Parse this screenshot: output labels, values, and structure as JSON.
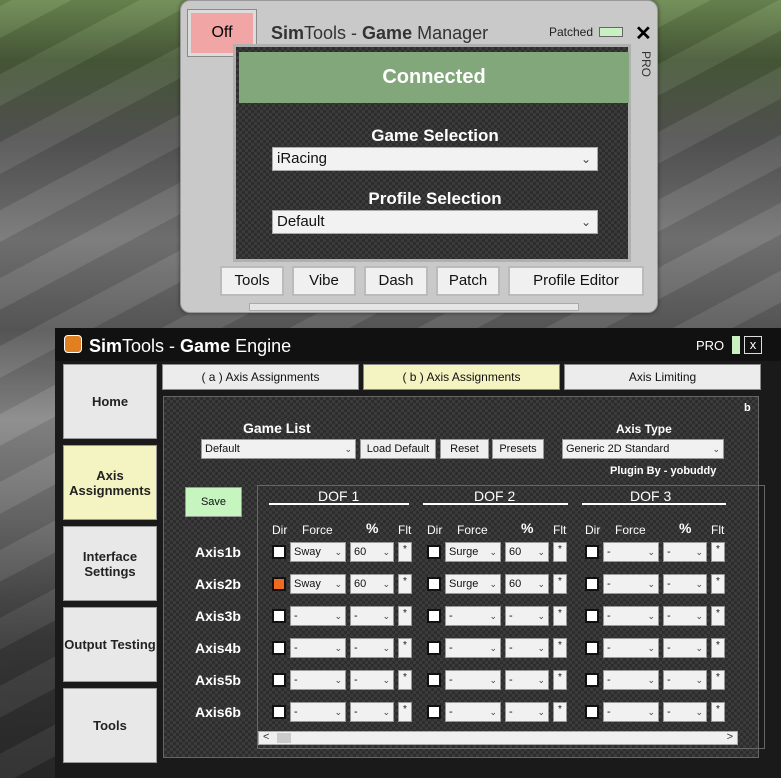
{
  "manager": {
    "off_label": "Off",
    "title_a": "Sim",
    "title_b": "Tools - ",
    "title_c": "Game",
    "title_d": " Manager",
    "patched_label": "Patched",
    "close_glyph": "✕",
    "pro_label": "PRO",
    "status": "Connected",
    "game_selection_label": "Game Selection",
    "game_selection_value": "iRacing",
    "profile_selection_label": "Profile Selection",
    "profile_selection_value": "Default",
    "tabs": [
      "Tools",
      "Vibe",
      "Dash",
      "Patch",
      "Profile Editor"
    ]
  },
  "engine": {
    "title_a": "Sim",
    "title_b": "Tools - ",
    "title_c": "Game",
    "title_d": " Engine",
    "pro_label": "PRO",
    "close_glyph": "x",
    "nav": [
      "Home",
      "Axis Assignments",
      "Interface Settings",
      "Output Testing",
      "Tools"
    ],
    "tabs": [
      "( a ) Axis Assignments",
      "( b ) Axis Assignments",
      "Axis Limiting"
    ],
    "corner_label": "b",
    "game_list_label": "Game List",
    "game_list_value": "Default",
    "load_default": "Load Default",
    "reset": "Reset",
    "presets": "Presets",
    "axis_type_label": "Axis Type",
    "axis_type_value": "Generic 2D Standard",
    "plugin_by": "Plugin By - yobuddy",
    "save": "Save",
    "dofs": [
      "DOF 1",
      "DOF 2",
      "DOF 3"
    ],
    "col_dir": "Dir",
    "col_force": "Force",
    "col_pct": "%",
    "col_flt": "Flt",
    "flt_glyph": "*",
    "rows": [
      {
        "axis": "Axis1b",
        "cells": [
          {
            "dir": false,
            "force": "Sway",
            "pct": "60"
          },
          {
            "dir": false,
            "force": "Surge",
            "pct": "60"
          },
          {
            "dir": false,
            "force": "-",
            "pct": "-"
          }
        ]
      },
      {
        "axis": "Axis2b",
        "cells": [
          {
            "dir": true,
            "force": "Sway",
            "pct": "60"
          },
          {
            "dir": false,
            "force": "Surge",
            "pct": "60"
          },
          {
            "dir": false,
            "force": "-",
            "pct": "-"
          }
        ]
      },
      {
        "axis": "Axis3b",
        "cells": [
          {
            "dir": false,
            "force": "-",
            "pct": "-"
          },
          {
            "dir": false,
            "force": "-",
            "pct": "-"
          },
          {
            "dir": false,
            "force": "-",
            "pct": "-"
          }
        ]
      },
      {
        "axis": "Axis4b",
        "cells": [
          {
            "dir": false,
            "force": "-",
            "pct": "-"
          },
          {
            "dir": false,
            "force": "-",
            "pct": "-"
          },
          {
            "dir": false,
            "force": "-",
            "pct": "-"
          }
        ]
      },
      {
        "axis": "Axis5b",
        "cells": [
          {
            "dir": false,
            "force": "-",
            "pct": "-"
          },
          {
            "dir": false,
            "force": "-",
            "pct": "-"
          },
          {
            "dir": false,
            "force": "-",
            "pct": "-"
          }
        ]
      },
      {
        "axis": "Axis6b",
        "cells": [
          {
            "dir": false,
            "force": "-",
            "pct": "-"
          },
          {
            "dir": false,
            "force": "-",
            "pct": "-"
          },
          {
            "dir": false,
            "force": "-",
            "pct": "-"
          }
        ]
      }
    ],
    "scroll_left": "<",
    "scroll_right": ">"
  },
  "colors": {
    "connected": "#82a77b",
    "off_button": "#f2a5a5",
    "active": "#f4f4c2",
    "dir_checked": "#ef6a1f",
    "save": "#c6f5c0"
  }
}
